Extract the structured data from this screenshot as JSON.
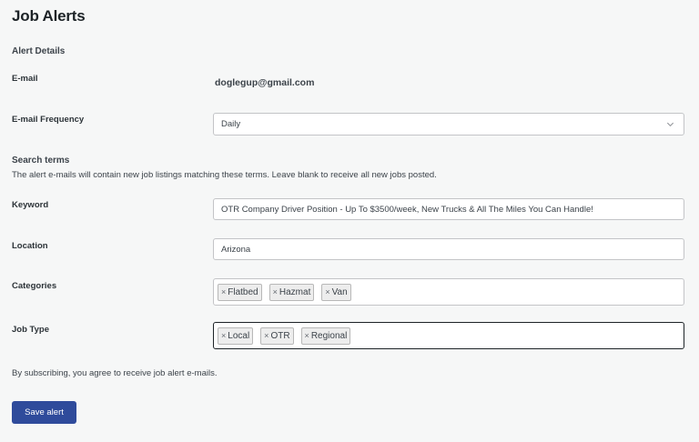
{
  "page": {
    "title": "Job Alerts"
  },
  "alert_details": {
    "heading": "Alert Details",
    "email_label": "E-mail",
    "email_value": "doglegup@gmail.com",
    "frequency_label": "E-mail Frequency",
    "frequency_selected": "Daily"
  },
  "search_terms": {
    "heading": "Search terms",
    "description": "The alert e-mails will contain new job listings matching these terms. Leave blank to receive all new jobs posted.",
    "keyword_label": "Keyword",
    "keyword_value": "OTR Company Driver Position - Up To $3500/week, New Trucks & All The Miles You Can Handle!",
    "location_label": "Location",
    "location_value": "Arizona",
    "categories_label": "Categories",
    "categories": [
      "Flatbed",
      "Hazmat",
      "Van"
    ],
    "job_type_label": "Job Type",
    "job_types": [
      "Local",
      "OTR",
      "Regional"
    ]
  },
  "footer": {
    "consent_text": "By subscribing, you agree to receive job alert e-mails.",
    "save_label": "Save alert"
  },
  "icons": {
    "token_remove": "×",
    "frequency_dropdown": "chevron-down-icon"
  },
  "colors": {
    "primary_button": "#2f4b9b",
    "page_background": "#f6f7f7"
  }
}
